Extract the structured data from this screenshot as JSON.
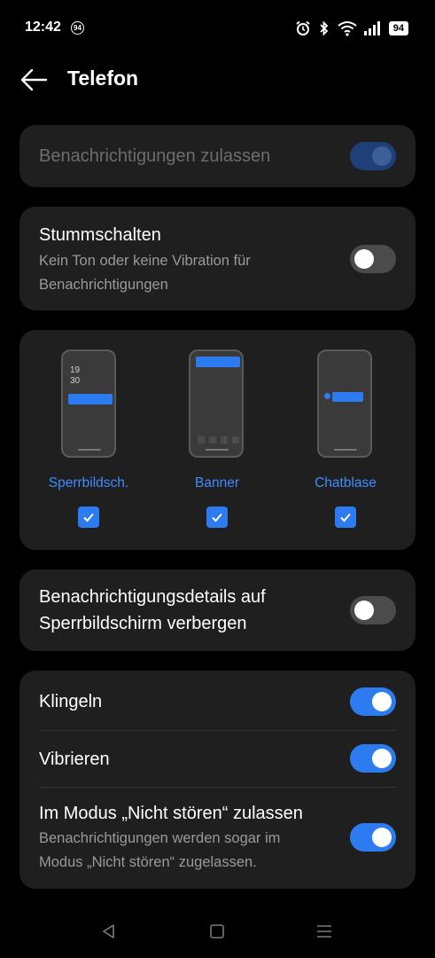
{
  "status_bar": {
    "time": "12:42",
    "notification_badge": "94",
    "battery_level": "94",
    "icons": [
      "alarm-icon",
      "bluetooth-icon",
      "wifi-icon",
      "signal-icon",
      "battery-icon"
    ]
  },
  "header": {
    "back_icon": "arrow-left-icon",
    "title": "Telefon"
  },
  "allow_notifications": {
    "label": "Benachrichtigungen zulassen",
    "enabled": true,
    "disabled_state": true
  },
  "mute": {
    "title": "Stummschalten",
    "subtitle_line1": "Kein Ton oder keine Vibration für",
    "subtitle_line2": "Benachrichtigungen",
    "enabled": false
  },
  "styles": {
    "options": [
      {
        "label": "Sperrbildsch.",
        "checked": true
      },
      {
        "label": "Banner",
        "checked": true
      },
      {
        "label": "Chatblase",
        "checked": true
      }
    ],
    "lockscreen_clock_hours": "19",
    "lockscreen_clock_minutes": "30"
  },
  "hide_details": {
    "title_line1": "Benachrichtigungsdetails auf",
    "title_line2": "Sperrbildschirm verbergen",
    "enabled": false
  },
  "sound_settings": {
    "ring_label": "Klingeln",
    "ring_enabled": true,
    "vibrate_label": "Vibrieren",
    "vibrate_enabled": true,
    "dnd_title": "Im Modus „Nicht stören“ zulassen",
    "dnd_sub_line1": "Benachrichtigungen werden sogar im",
    "dnd_sub_line2": "Modus „Nicht stören“ zugelassen.",
    "dnd_enabled": true
  },
  "nav_bar": {
    "icons": [
      "back-triangle-icon",
      "home-square-icon",
      "recents-menu-icon"
    ]
  },
  "colors": {
    "background": "#000000",
    "card": "#1f1f1f",
    "accent": "#2d7bf0",
    "accent_text": "#3f8cff",
    "secondary_text": "#9a9a9a"
  }
}
